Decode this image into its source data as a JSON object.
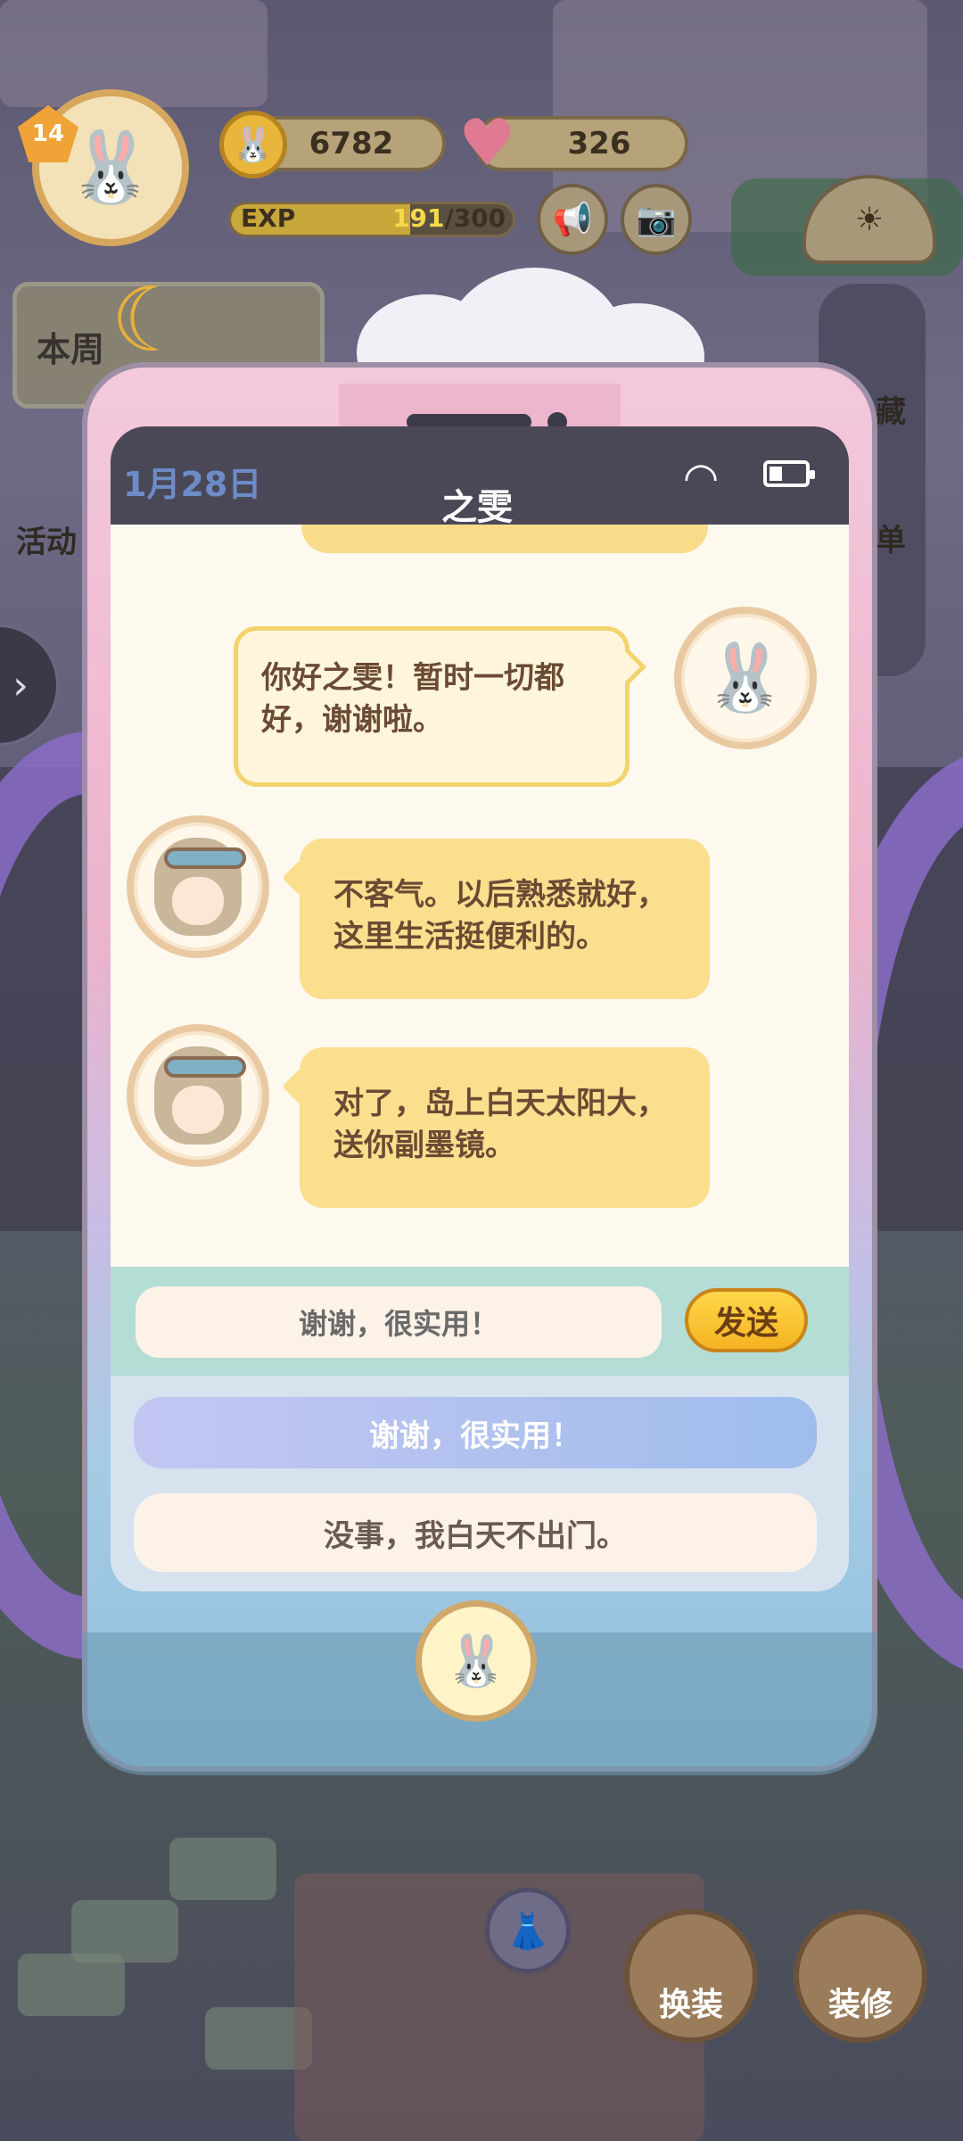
{
  "hud": {
    "level": "14",
    "coins": "6782",
    "hearts": "326",
    "exp_label": "EXP",
    "exp_current": "191",
    "exp_max": "/300",
    "exp_progress": 0.637,
    "left_card_label": "本周",
    "side_left_label": "活动",
    "side_right_label_1": "藏",
    "side_right_label_2": "单"
  },
  "phone": {
    "date": "1月28日",
    "contact_name": "之雯"
  },
  "chat": {
    "messages": [
      {
        "sender": "me",
        "text": "你好之雯！暂时一切都好，谢谢啦。"
      },
      {
        "sender": "them",
        "text": "不客气。以后熟悉就好，这里生活挺便利的。"
      },
      {
        "sender": "them",
        "text": "对了，岛上白天太阳大，送你副墨镜。"
      }
    ]
  },
  "reply": {
    "input_value": "谢谢，很实用！",
    "send_label": "发送",
    "options": [
      "谢谢，很实用！",
      "没事，我白天不出门。"
    ]
  },
  "bottom": {
    "dress_label": "换装",
    "decorate_label": "装修"
  },
  "colors": {
    "phone_pink": "#f4c9dc",
    "bubble_yellow": "#fbdf8e",
    "send_button": "#ffd84a",
    "option_selected": "#9fbdec"
  }
}
